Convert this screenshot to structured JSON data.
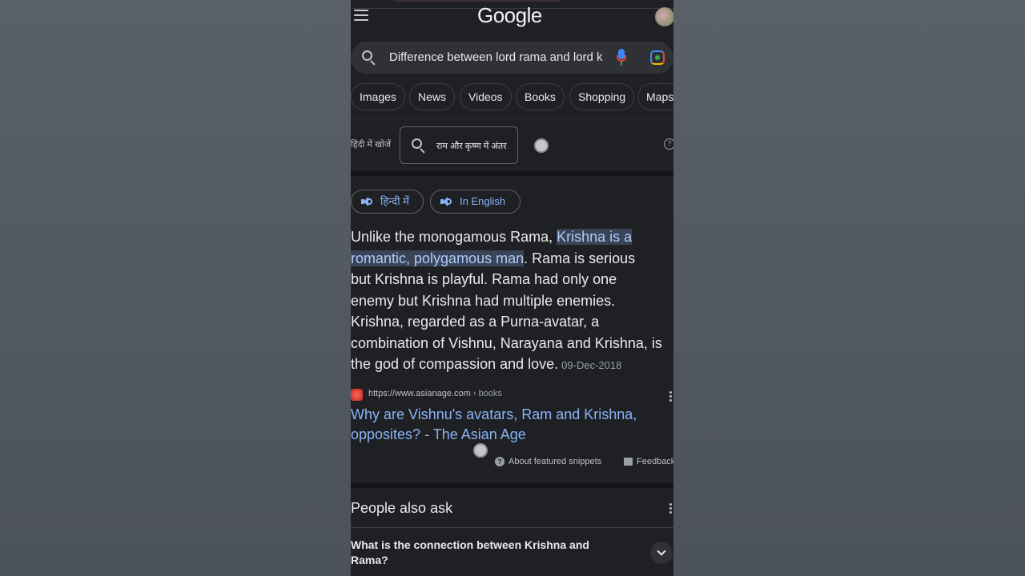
{
  "app": {
    "logo": "Google"
  },
  "search": {
    "query": "Difference between lord rama and lord k"
  },
  "chips": [
    "Images",
    "News",
    "Videos",
    "Books",
    "Shopping",
    "Maps"
  ],
  "hindi": {
    "label": "हिंदी में खोजें",
    "query": "राम और कृष्ण में अंतर"
  },
  "language_buttons": {
    "hindi": "हिन्दी में",
    "english": "In English"
  },
  "snippet": {
    "line1_pre": "Unlike the monogamous Rama, ",
    "line1_hl": "Krishna is a",
    "line2_hl": "romantic, polygamous man",
    "line2_post": ". Rama is serious",
    "line3": "but Krishna is playful. Rama had only one",
    "line4": "enemy but Krishna had multiple enemies.",
    "line5": "Krishna, regarded as a Purna-avatar, a",
    "line6": "combination of Vishnu, Narayana and Krishna, is",
    "line7": "the god of compassion and love.",
    "date": "09-Dec-2018"
  },
  "source": {
    "url": "https://www.asianage.com",
    "path": " › books",
    "title_line1": "Why are Vishnu's avatars, Ram and Krishna,",
    "title_line2": "opposites? - The Asian Age"
  },
  "meta": {
    "about": "About featured snippets",
    "feedback": "Feedback"
  },
  "people_also_ask": {
    "title": "People also ask",
    "question1_line1": "What is the connection between Krishna and",
    "question1_line2": "Rama?"
  },
  "colors": {
    "link": "#8ab4f8",
    "highlight_bg": "#394457",
    "page_bg": "#1f2023"
  }
}
